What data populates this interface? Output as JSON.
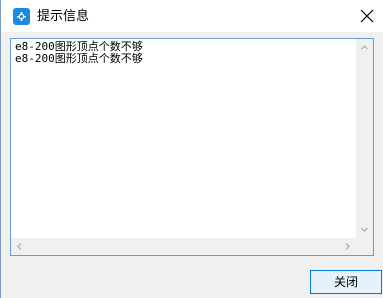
{
  "window": {
    "title": "提示信息",
    "icon": "app-icon",
    "close_icon": "close-icon"
  },
  "message": {
    "lines": [
      "e8-200图形顶点个数不够",
      "e8-200图形顶点个数不够"
    ]
  },
  "footer": {
    "close_label": "关闭"
  },
  "colors": {
    "accent": "#0078d7",
    "icon_blue": "#1a8be0"
  }
}
